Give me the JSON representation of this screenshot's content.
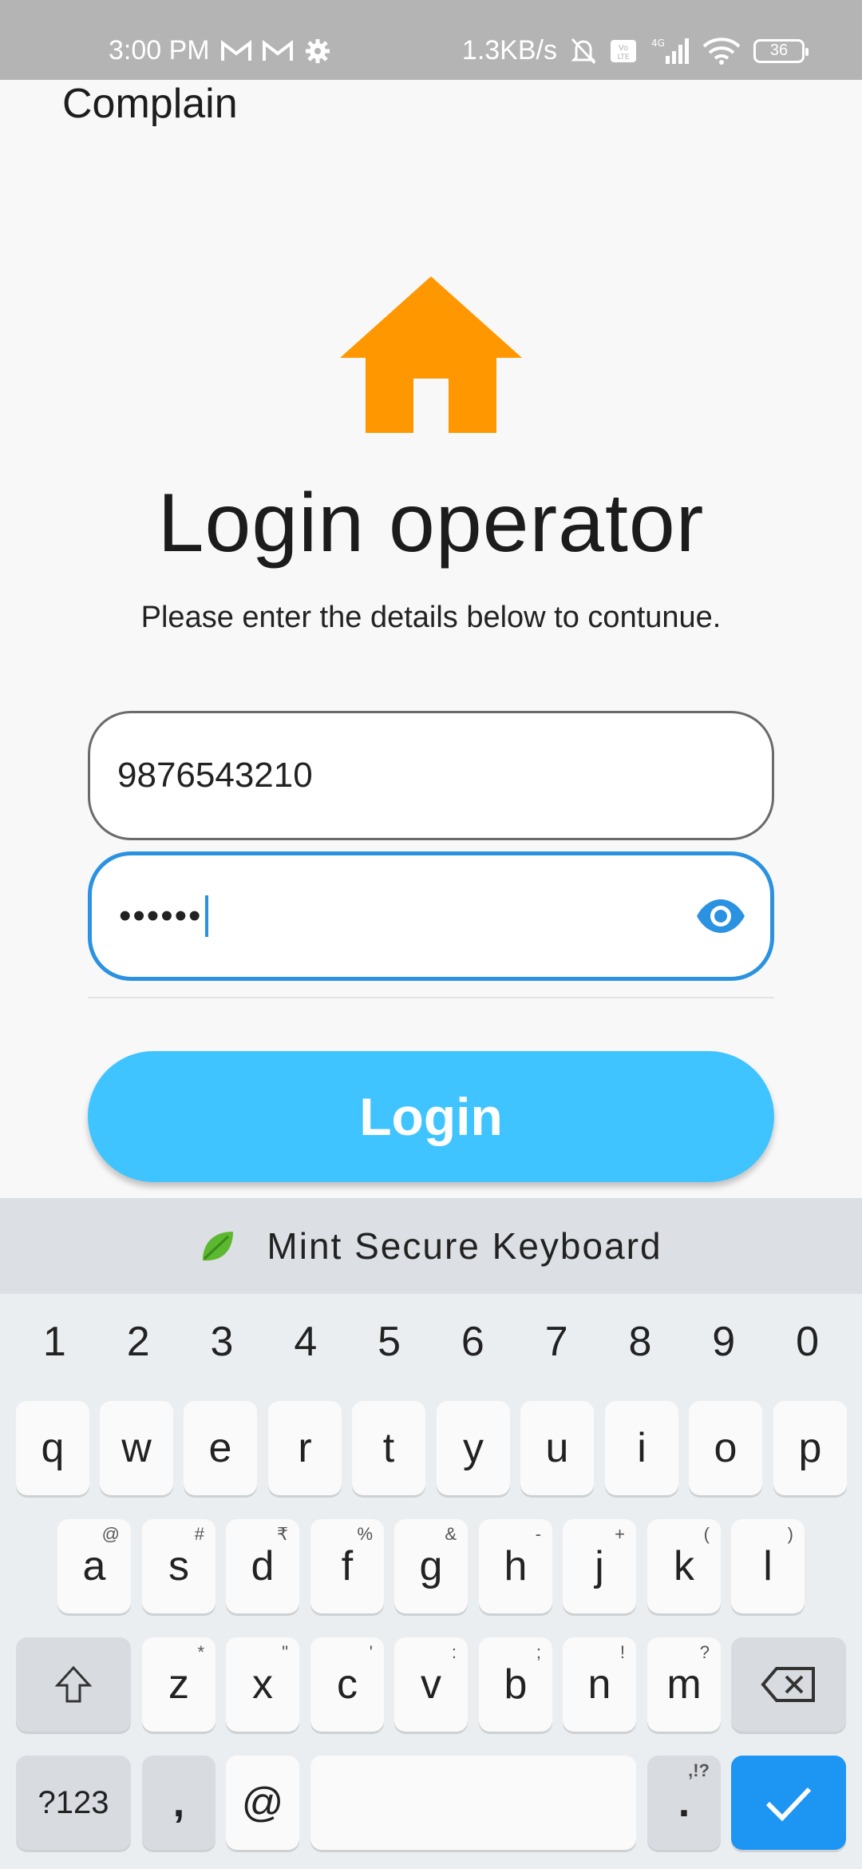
{
  "status_bar": {
    "time": "3:00 PM",
    "speed": "1.3KB/s",
    "battery": "36",
    "lte": "Vo LTE",
    "network": "4G"
  },
  "app": {
    "title": "Complain",
    "heading": "Login operator",
    "subtitle": "Please enter the details below to contunue.",
    "phone_value": "9876543210",
    "password_value": "••••••",
    "login_label": "Login",
    "accent_color": "#40c4ff",
    "focus_color": "#2a92e0",
    "icon_color": "#ff9800"
  },
  "keyboard": {
    "banner": "Mint Secure Keyboard",
    "numbers": [
      "1",
      "2",
      "3",
      "4",
      "5",
      "6",
      "7",
      "8",
      "9",
      "0"
    ],
    "row1": [
      "q",
      "w",
      "e",
      "r",
      "t",
      "y",
      "u",
      "i",
      "o",
      "p"
    ],
    "row2": [
      "a",
      "s",
      "d",
      "f",
      "g",
      "h",
      "j",
      "k",
      "l"
    ],
    "row2_hints": [
      "@",
      "#",
      "₹",
      "%",
      "&",
      "-",
      "+",
      "(",
      ")"
    ],
    "row3": [
      "z",
      "x",
      "c",
      "v",
      "b",
      "n",
      "m"
    ],
    "row3_hints": [
      "*",
      "\"",
      "'",
      ":",
      ";",
      "!",
      "?"
    ],
    "symbols_label": "?123",
    "comma_label": ",",
    "at_label": "@",
    "period_label": ".",
    "period_hint": ",!?"
  }
}
